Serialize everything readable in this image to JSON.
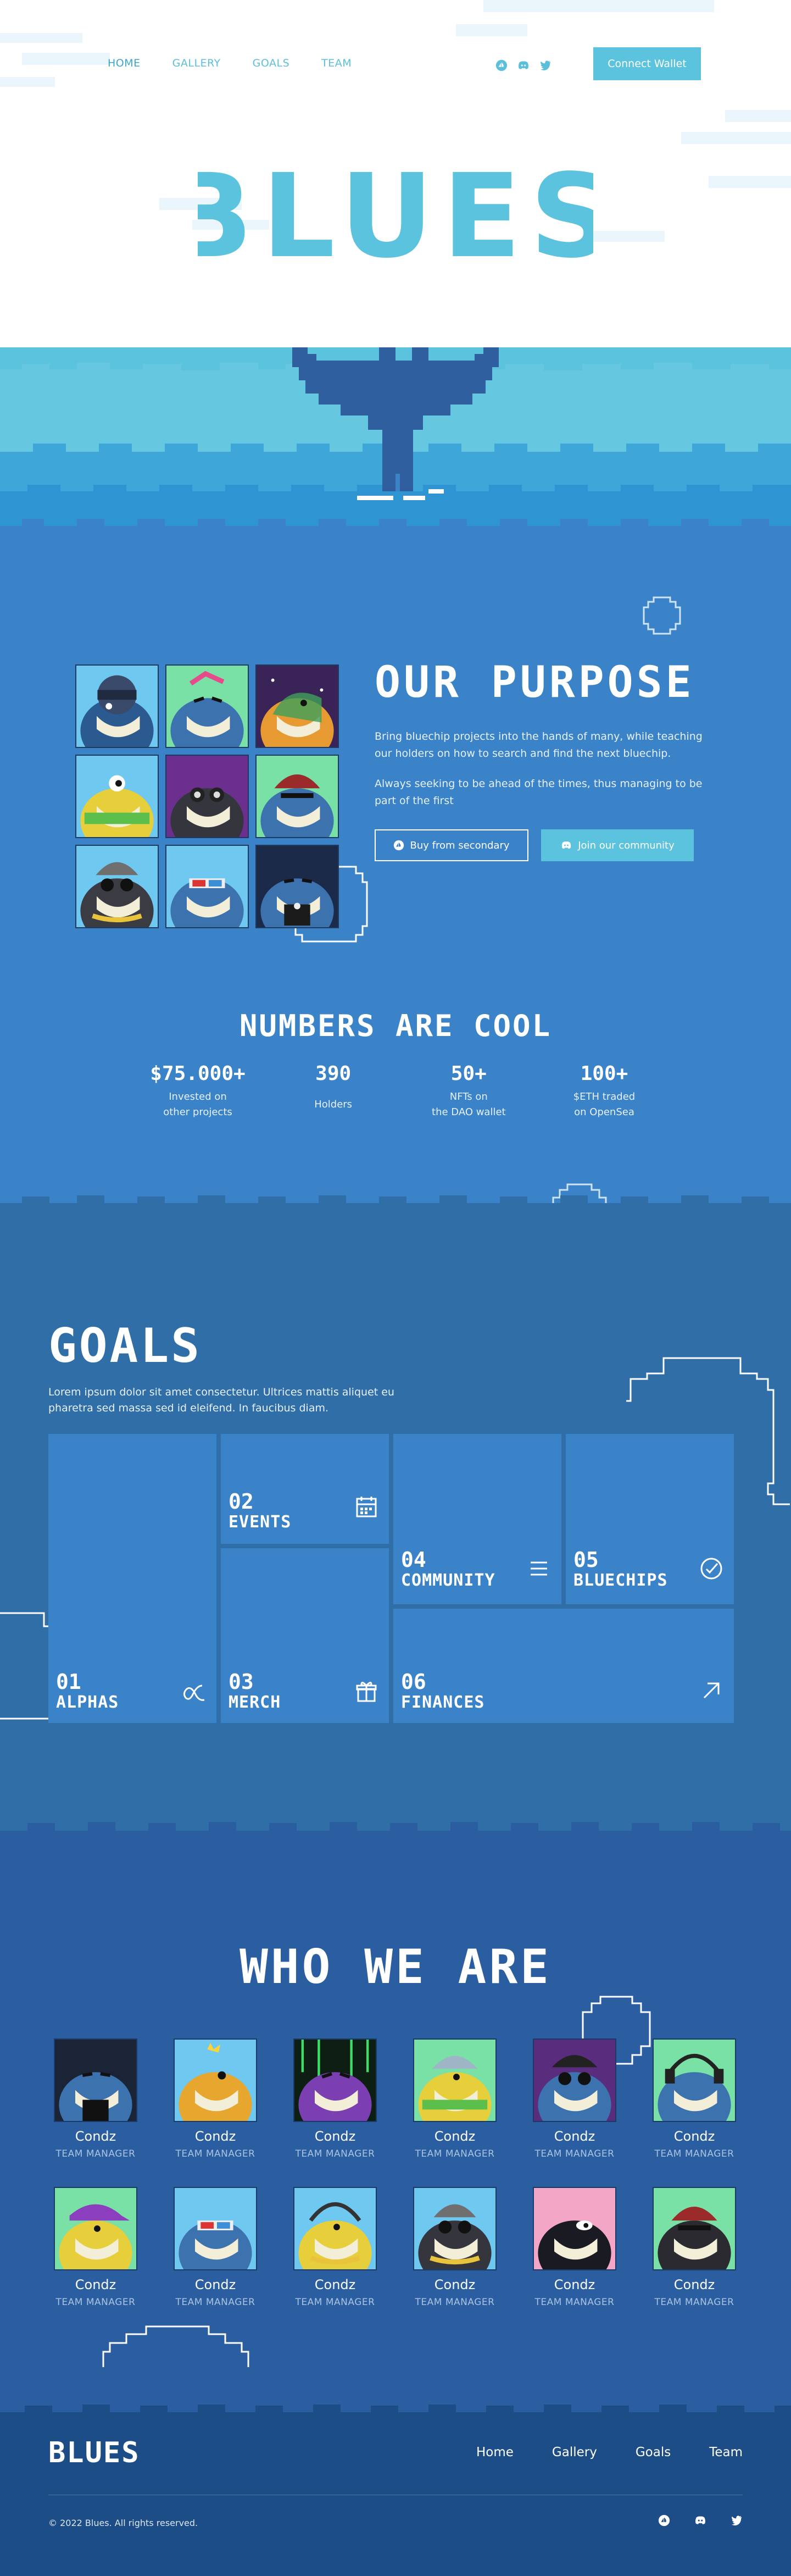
{
  "nav": {
    "links": [
      "HOME",
      "GALLERY",
      "GOALS",
      "TEAM"
    ],
    "active": "HOME",
    "social_icons": [
      "opensea-icon",
      "discord-icon",
      "twitter-icon"
    ],
    "connect_label": "Connect Wallet"
  },
  "hero": {
    "title": "BLUES"
  },
  "purpose": {
    "title": "OUR PURPOSE",
    "paragraph_1": "Bring bluechip projects into the hands of many, while teaching our holders on how to search and find the next bluechip.",
    "paragraph_2": "Always seeking to be ahead of the times, thus managing to be part of the first",
    "buy_label": "Buy from secondary",
    "join_label": "Join our community"
  },
  "numbers": {
    "title": "NUMBERS ARE COOL",
    "stats": [
      {
        "value": "$75.000+",
        "line1": "Invested on",
        "line2": "other projects"
      },
      {
        "value": "390",
        "line1": "Holders",
        "line2": ""
      },
      {
        "value": "50+",
        "line1": "NFTs on",
        "line2": "the DAO wallet"
      },
      {
        "value": "100+",
        "line1": "$ETH traded",
        "line2": "on OpenSea"
      }
    ]
  },
  "goals": {
    "title": "GOALS",
    "description": "Lorem ipsum dolor sit amet consectetur. Ultrices mattis aliquet eu pharetra sed massa sed id eleifend. In faucibus diam.",
    "cards": [
      {
        "num": "01",
        "name": "ALPHAS",
        "icon": "alpha-icon"
      },
      {
        "num": "02",
        "name": "EVENTS",
        "icon": "calendar-icon"
      },
      {
        "num": "03",
        "name": "MERCH",
        "icon": "gift-icon"
      },
      {
        "num": "04",
        "name": "COMMUNITY",
        "icon": "menu-icon"
      },
      {
        "num": "05",
        "name": "BLUECHIPS",
        "icon": "check-circle-icon"
      },
      {
        "num": "06",
        "name": "FINANCES",
        "icon": "arrow-up-right-icon"
      }
    ]
  },
  "team": {
    "title": "WHO WE ARE",
    "members": [
      {
        "name": "Condz",
        "role": "TEAM MANAGER"
      },
      {
        "name": "Condz",
        "role": "TEAM MANAGER"
      },
      {
        "name": "Condz",
        "role": "TEAM MANAGER"
      },
      {
        "name": "Condz",
        "role": "TEAM MANAGER"
      },
      {
        "name": "Condz",
        "role": "TEAM MANAGER"
      },
      {
        "name": "Condz",
        "role": "TEAM MANAGER"
      },
      {
        "name": "Condz",
        "role": "TEAM MANAGER"
      },
      {
        "name": "Condz",
        "role": "TEAM MANAGER"
      },
      {
        "name": "Condz",
        "role": "TEAM MANAGER"
      },
      {
        "name": "Condz",
        "role": "TEAM MANAGER"
      },
      {
        "name": "Condz",
        "role": "TEAM MANAGER"
      },
      {
        "name": "Condz",
        "role": "TEAM MANAGER"
      }
    ]
  },
  "footer": {
    "logo": "BLUES",
    "links": [
      "Home",
      "Gallery",
      "Goals",
      "Team"
    ],
    "copyright": "© 2022 Blues. All rights reserved.",
    "social_icons": [
      "opensea-icon",
      "discord-icon",
      "twitter-icon"
    ]
  },
  "colors": {
    "accent": "#5bc3dd",
    "purpose_bg": "#3b83c9",
    "goals_bg": "#306ea8",
    "team_bg": "#2b5ea0",
    "footer_bg": "#1d4d86",
    "whale": "#2f5f9f"
  }
}
